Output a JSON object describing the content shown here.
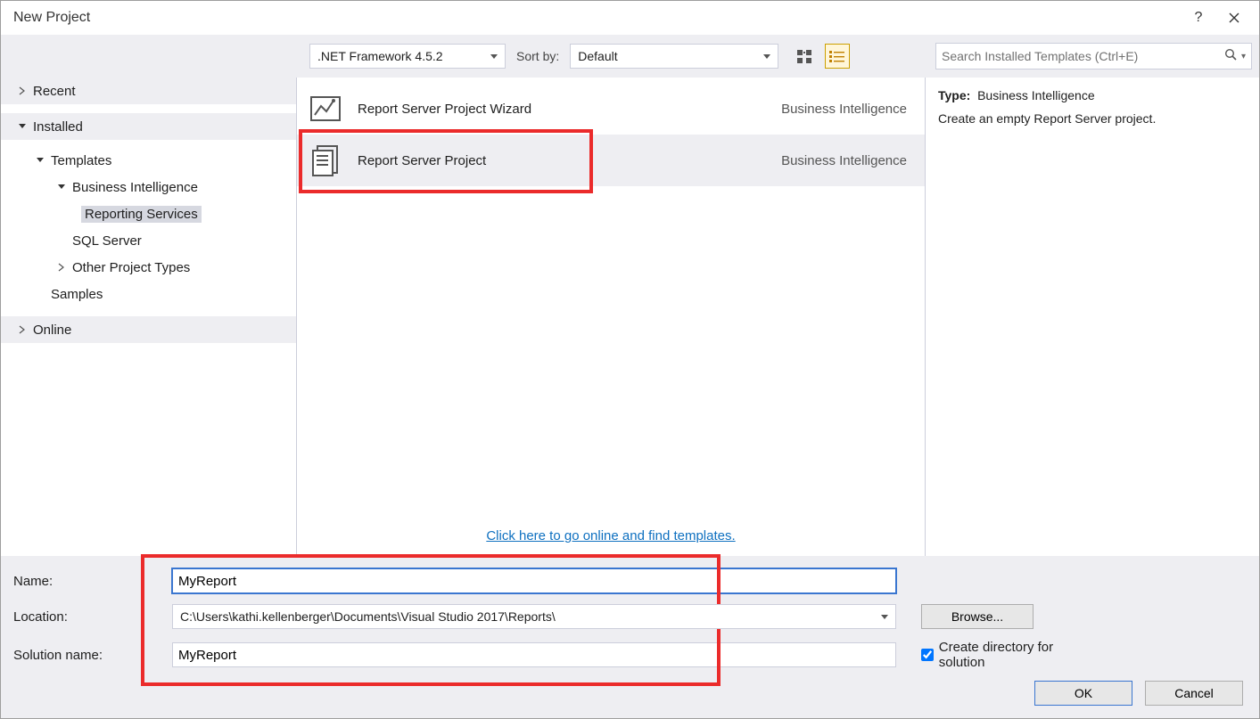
{
  "title": "New Project",
  "toolbar": {
    "framework": ".NET Framework 4.5.2",
    "sort_label": "Sort by:",
    "sort_value": "Default",
    "search_placeholder": "Search Installed Templates (Ctrl+E)"
  },
  "tree": {
    "recent": "Recent",
    "installed": "Installed",
    "templates": "Templates",
    "business_intelligence": "Business Intelligence",
    "reporting_services": "Reporting Services",
    "sql_server": "SQL Server",
    "other_project_types": "Other Project Types",
    "samples": "Samples",
    "online": "Online"
  },
  "templates": [
    {
      "name": "Report Server Project Wizard",
      "category": "Business Intelligence"
    },
    {
      "name": "Report Server Project",
      "category": "Business Intelligence"
    }
  ],
  "online_link": "Click here to go online and find templates.",
  "details": {
    "type_label": "Type:",
    "type_value": "Business Intelligence",
    "description": "Create an empty Report Server project."
  },
  "form": {
    "name_label": "Name:",
    "name_value": "MyReport",
    "location_label": "Location:",
    "location_value": "C:\\Users\\kathi.kellenberger\\Documents\\Visual Studio 2017\\Reports\\",
    "solution_label": "Solution name:",
    "solution_value": "MyReport",
    "browse_label": "Browse...",
    "create_dir_label": "Create directory for solution",
    "ok_label": "OK",
    "cancel_label": "Cancel"
  }
}
